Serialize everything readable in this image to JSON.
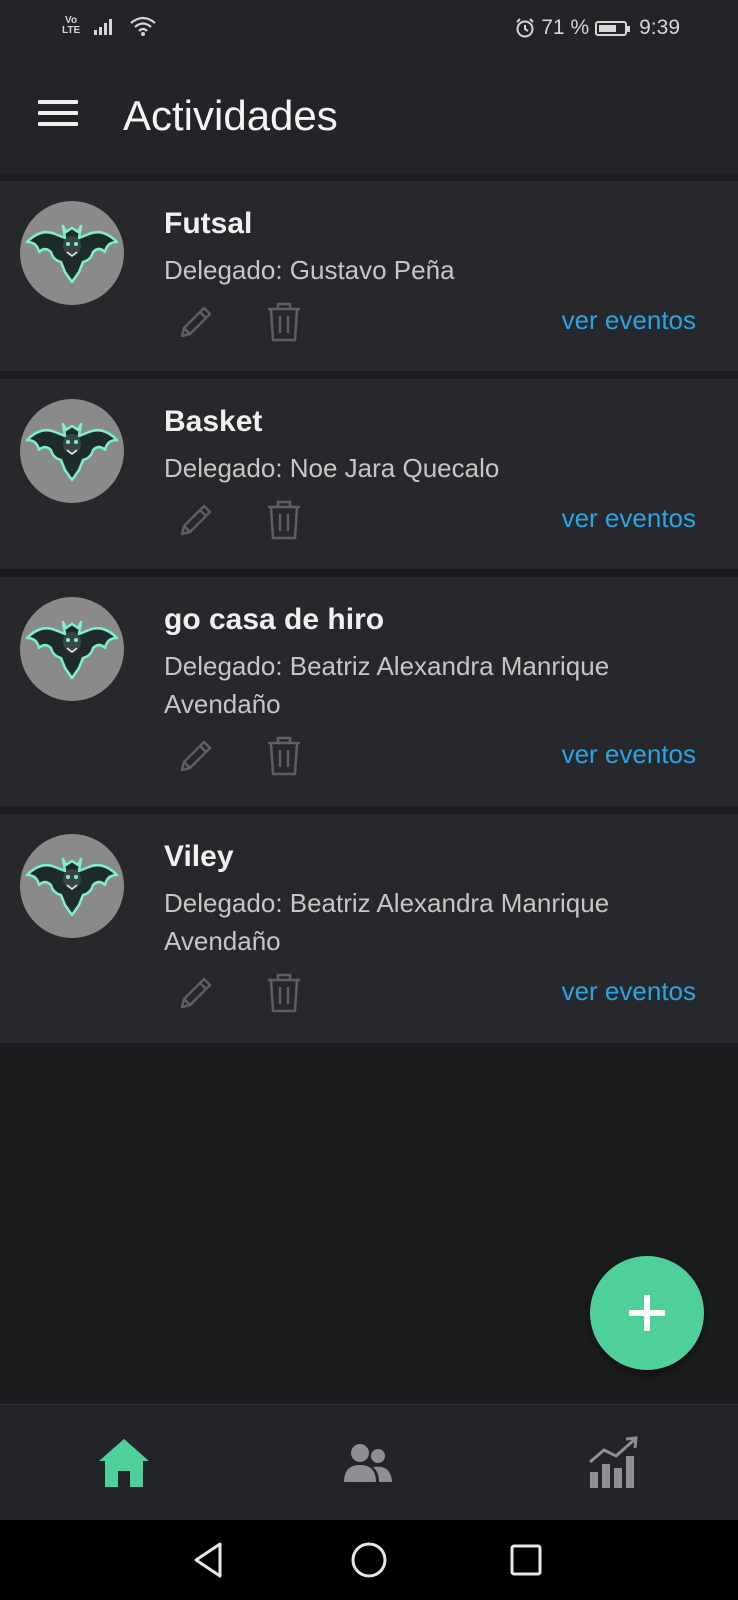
{
  "status": {
    "network": "LTE",
    "volte": "Vo",
    "battery_percent": "71 %",
    "battery_level": 0.71,
    "time": "9:39"
  },
  "app_bar": {
    "title": "Actividades"
  },
  "activities": [
    {
      "name": "Futsal",
      "delegate": "Delegado: Gustavo Peña",
      "link": "ver eventos"
    },
    {
      "name": "Basket",
      "delegate": "Delegado: Noe Jara Quecalo",
      "link": "ver eventos"
    },
    {
      "name": "go casa de hiro",
      "delegate": "Delegado: Beatriz Alexandra Manrique Avendaño",
      "link": "ver eventos"
    },
    {
      "name": "Viley",
      "delegate": "Delegado: Beatriz Alexandra Manrique Avendaño",
      "link": "ver eventos"
    }
  ],
  "icons": {
    "menu": "menu-icon",
    "edit": "pencil-icon",
    "delete": "trash-icon",
    "fab": "plus-icon",
    "home": "home-icon",
    "people": "users-icon",
    "stats": "chart-icon"
  },
  "colors": {
    "accent": "#4fd09b",
    "link": "#2aa4e3",
    "background": "#1b1c1e",
    "card": "#27282b"
  }
}
